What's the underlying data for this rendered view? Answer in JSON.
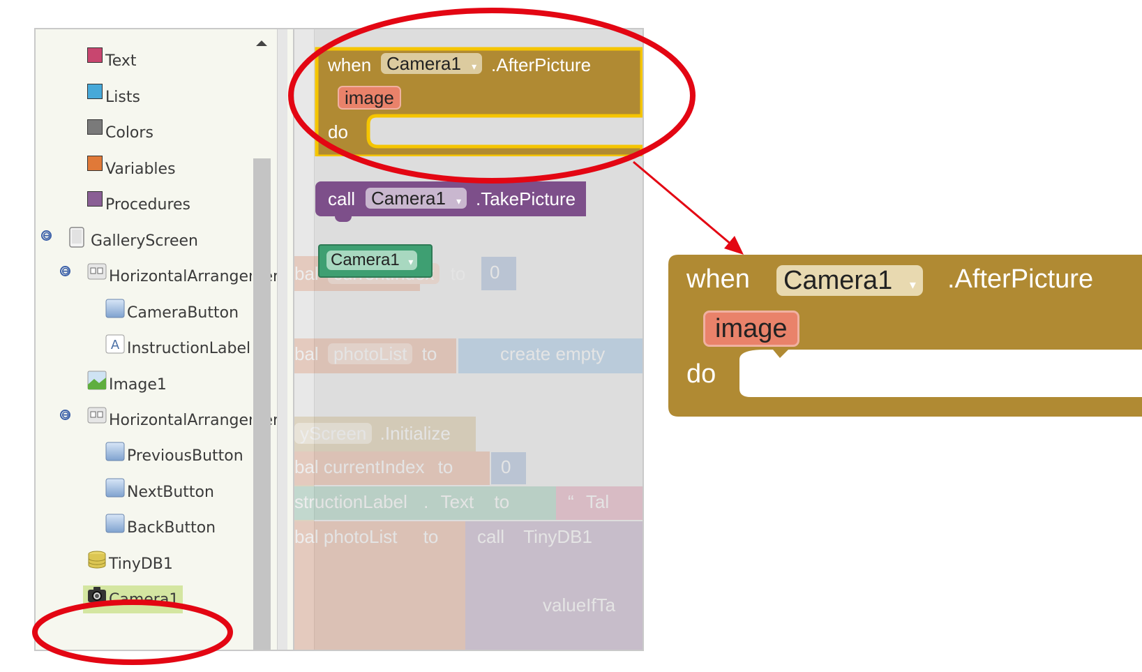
{
  "tree": {
    "builtins": [
      {
        "label": "Text",
        "color": "#c8466f",
        "icon": "text-swatch"
      },
      {
        "label": "Lists",
        "color": "#47a9d9",
        "icon": "lists-swatch"
      },
      {
        "label": "Colors",
        "color": "#7a7a7a",
        "icon": "colors-swatch"
      },
      {
        "label": "Variables",
        "color": "#e07938",
        "icon": "variables-swatch"
      },
      {
        "label": "Procedures",
        "color": "#8a5f95",
        "icon": "procedures-swatch"
      }
    ],
    "screen": {
      "label": "GalleryScreen",
      "icon": "screen-icon"
    },
    "components": [
      {
        "label": "HorizontalArrangemen",
        "icon": "arrangement-icon"
      },
      {
        "label": "CameraButton",
        "icon": "button-icon"
      },
      {
        "label": "InstructionLabel",
        "icon": "label-icon"
      },
      {
        "label": "Image1",
        "icon": "image-icon"
      },
      {
        "label": "HorizontalArrangemen",
        "icon": "arrangement-icon"
      },
      {
        "label": "PreviousButton",
        "icon": "button-icon"
      },
      {
        "label": "NextButton",
        "icon": "button-icon"
      },
      {
        "label": "BackButton",
        "icon": "button-icon"
      },
      {
        "label": "TinyDB1",
        "icon": "database-icon"
      },
      {
        "label": "Camera1",
        "icon": "camera-icon",
        "selected": true
      }
    ],
    "collapse_glyph": "⊖"
  },
  "workspace": {
    "event_block": {
      "when": "when",
      "component": "Camera1",
      "event": ".AfterPicture",
      "param": "image",
      "do": "do",
      "color": "#b08a33"
    },
    "call_block": {
      "call": "call",
      "component": "Camera1",
      "method": ".TakePicture",
      "color": "#7d4f8a"
    },
    "getter_block": {
      "component": "Camera1",
      "color": "#3e9f72"
    },
    "faded": {
      "g1_prefix": "bal",
      "g1_var": "currentIndex",
      "g1_to": "to",
      "g1_val": "0",
      "g2_prefix": "bal",
      "g2_var": "photoList",
      "g2_to": "to",
      "g2_create": "create empty",
      "init_screen": "yScreen",
      "init_event": ".Initialize",
      "s1_var": "bal currentIndex",
      "s1_to": "to",
      "s1_val": "0",
      "s2_comp": "structionLabel",
      "s2_dot": ".",
      "s2_prop": "Text",
      "s2_to": "to",
      "s2_text": "Tal",
      "s3_var": "bal photoList",
      "s3_to": "to",
      "s3_call": "call",
      "s3_comp": "TinyDB1",
      "value_if": "valueIfTa"
    },
    "dropdown_glyph": "▾",
    "quote_glyph": "“"
  },
  "zoom": {
    "when": "when",
    "component": "Camera1",
    "event": ".AfterPicture",
    "param": "image",
    "do": "do"
  },
  "annotation_color": "#e30613"
}
